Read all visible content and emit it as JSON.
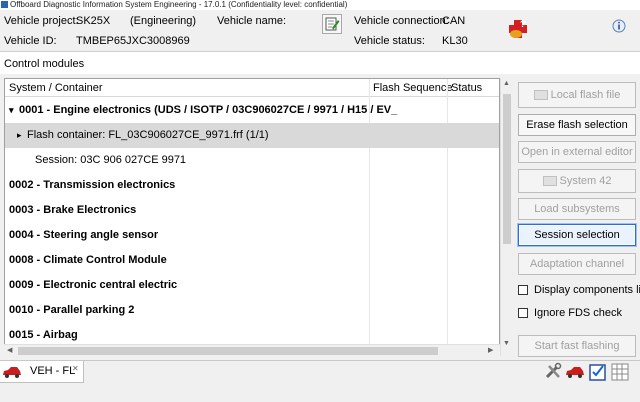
{
  "window": {
    "title": "Offboard Diagnostic Information System Engineering - 17.0.1 (Confidentiality level: confidential)"
  },
  "info": {
    "vehicle_project_label": "Vehicle project:",
    "vehicle_project_value": "SK25X",
    "vehicle_project_type": "(Engineering)",
    "vehicle_name_label": "Vehicle name:",
    "vehicle_id_label": "Vehicle ID:",
    "vehicle_id_value": "TMBEP65JXC3008969",
    "vehicle_connection_label": "Vehicle connection:",
    "vehicle_connection_value": "CAN",
    "vehicle_status_label": "Vehicle status:",
    "vehicle_status_value": "KL30"
  },
  "control_modules": {
    "section_label": "Control modules",
    "columns": {
      "system": "System / Container",
      "flash": "Flash Sequence",
      "status": "Status"
    },
    "rows": [
      {
        "text": "0001 - Engine electronics  (UDS / ISOTP / 03C906027CE / 9971 / H15 / EV_",
        "bold": true,
        "level": 0,
        "expand": "▾"
      },
      {
        "text": "Flash container: FL_03C906027CE_9971.frf (1/1)",
        "bold": false,
        "level": 1,
        "expand": "▸",
        "selected": true
      },
      {
        "text": "Session: 03C 906 027CE 9971",
        "bold": false,
        "level": 2,
        "expand": ""
      },
      {
        "text": "0002 - Transmission electronics",
        "bold": true,
        "level": 0,
        "expand": ""
      },
      {
        "text": "0003 - Brake Electronics",
        "bold": true,
        "level": 0,
        "expand": ""
      },
      {
        "text": "0004 - Steering angle sensor",
        "bold": true,
        "level": 0,
        "expand": ""
      },
      {
        "text": "0008 - Climate Control Module",
        "bold": true,
        "level": 0,
        "expand": ""
      },
      {
        "text": "0009 - Electronic central electric",
        "bold": true,
        "level": 0,
        "expand": ""
      },
      {
        "text": "0010 - Parallel parking 2",
        "bold": true,
        "level": 0,
        "expand": ""
      },
      {
        "text": "0015 - Airbag",
        "bold": true,
        "level": 0,
        "expand": ""
      }
    ]
  },
  "buttons": {
    "local_flash_file": "Local flash file",
    "erase_flash_selection": "Erase flash selection",
    "open_external_editor": "Open in external editor",
    "system_42": "System 42",
    "load_subsystems": "Load subsystems",
    "session_selection": "Session selection",
    "adaptation_channel": "Adaptation channel",
    "start_fast_flashing": "Start fast flashing"
  },
  "checkboxes": {
    "display_components": "Display components list",
    "ignore_fds": "Ignore FDS check"
  },
  "bottom": {
    "tab_label": "VEH - FL",
    "tab_close": "✕"
  },
  "icons": {
    "app": "app-icon",
    "edit": "edit-note-icon",
    "red_cross": "red-cross-help-icon",
    "info": "info-icon",
    "car": "car-icon",
    "tools": "tools-icon",
    "car_tool": "car-tool-icon",
    "checklist": "checklist-icon",
    "grid": "grid-icon"
  },
  "colors": {
    "accent": "#2a6fd6",
    "selected_row": "#d9d9d9",
    "red_cross": "#d42020",
    "car": "#c81e1e"
  }
}
